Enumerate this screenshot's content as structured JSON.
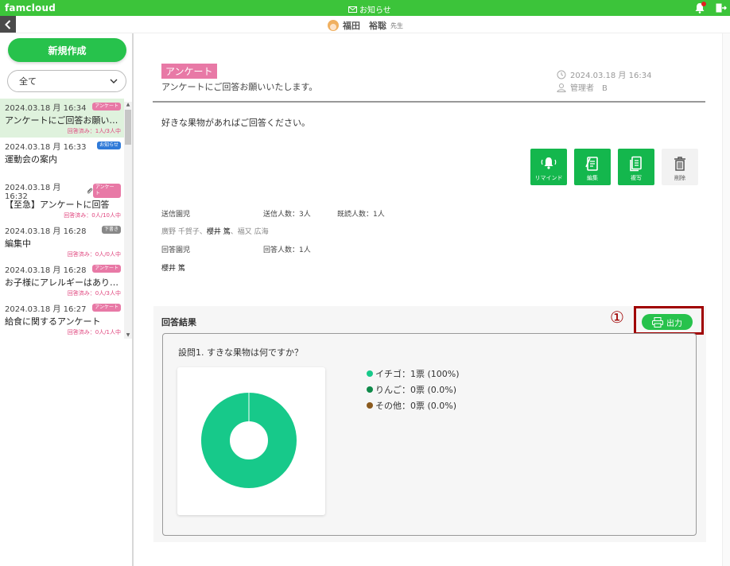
{
  "topbar": {
    "app_name": "famcloud",
    "notice_label": "お知らせ"
  },
  "user": {
    "name": "福田　裕聡",
    "suffix": "先生"
  },
  "sidebar": {
    "new_button": "新規作成",
    "filter_value": "全て",
    "items": [
      {
        "datetime": "2024.03.18 月 16:34",
        "badge": "アンケート",
        "badge_type": "survey",
        "title": "アンケートにご回答お願い…",
        "status": "回答済み：1人/3人中",
        "selected": true
      },
      {
        "datetime": "2024.03.18 月 16:33",
        "badge": "お知らせ",
        "badge_type": "notice",
        "title": "運動会の案内",
        "status": ""
      },
      {
        "datetime": "2024.03.18 月 16:32",
        "badge": "アンケート",
        "badge_type": "survey",
        "title": "【至急】アンケートに回答",
        "status": "回答済み：0人/10人中",
        "attachment": true
      },
      {
        "datetime": "2024.03.18 月 16:28",
        "badge": "下書き",
        "badge_type": "draft",
        "title": "編集中",
        "status": "回答済み：0人/0人中"
      },
      {
        "datetime": "2024.03.18 月 16:28",
        "badge": "アンケート",
        "badge_type": "survey",
        "title": "お子様にアレルギーはあり…",
        "status": "回答済み：0人/3人中"
      },
      {
        "datetime": "2024.03.18 月 16:27",
        "badge": "アンケート",
        "badge_type": "survey",
        "title": "給食に関するアンケート",
        "status": "回答済み：0人/1人中"
      }
    ]
  },
  "message": {
    "tag": "アンケート",
    "subtitle": "アンケートにご回答お願いいたします。",
    "date": "2024.03.18 月 16:34",
    "author": "管理者　B",
    "body": "好きな果物があればご回答ください。"
  },
  "actions": {
    "remind": "リマインド",
    "edit": "編集",
    "copy": "複写",
    "delete": "削除"
  },
  "recipients": {
    "sent_label": "送信園児",
    "sent_count": "送信人数：3人",
    "read_count": "既読人数：1人",
    "names_muted_1": "廣野 千賀子、",
    "names_strong": "櫻井 篤",
    "names_muted_2": "、福又 広海",
    "answered_label": "回答園児",
    "answered_count": "回答人数：1人",
    "answered_names": "櫻井 篤"
  },
  "results": {
    "heading": "回答結果",
    "output_button": "出力",
    "annotation": "①",
    "question": "設問1. すきな果物は何ですか？"
  },
  "chart_data": {
    "type": "pie",
    "categories": [
      "イチゴ",
      "りんご",
      "その他"
    ],
    "values": [
      1,
      0,
      0
    ],
    "labels": [
      "イチゴ：1票 (100%)",
      "りんご：0票 (0.0%)",
      "その他：0票 (0.0%)"
    ],
    "colors": [
      "#17c98a",
      "#0f8a4a",
      "#8a5a1e"
    ],
    "donut": true
  }
}
